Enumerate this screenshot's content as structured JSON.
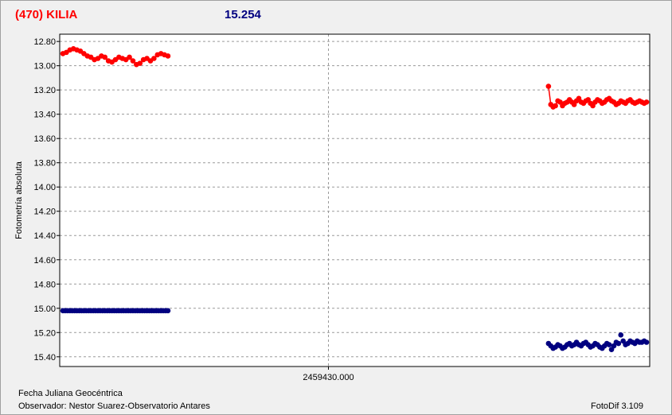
{
  "header": {
    "object": "(470) KILIA",
    "magnitude": "15.254",
    "object_color": "#ff0000",
    "magnitude_color": "#000080"
  },
  "footer": {
    "xlabel": "Fecha Juliana Geocéntrica",
    "observer": "Observador: Nestor Suarez-Observatorio Antares",
    "software": "FotoDif 3.109"
  },
  "chart_data": {
    "type": "scatter",
    "ylabel": "Fotometría absoluta",
    "y_inverted": true,
    "ylim": [
      12.74,
      15.48
    ],
    "yticks": [
      "12.80",
      "13.00",
      "13.20",
      "13.40",
      "13.60",
      "13.80",
      "14.00",
      "14.20",
      "14.40",
      "14.60",
      "14.80",
      "15.00",
      "15.20",
      "15.40"
    ],
    "x_center_tick": "2459430.000",
    "grid": true,
    "series": [
      {
        "color": "#ff0000",
        "connected": true,
        "x": [
          0.0,
          0.006,
          0.012,
          0.018,
          0.024,
          0.03,
          0.036,
          0.042,
          0.048,
          0.054,
          0.06,
          0.066,
          0.072,
          0.078,
          0.084,
          0.09,
          0.096,
          0.102,
          0.108,
          0.114,
          0.12,
          0.126,
          0.132,
          0.138,
          0.144,
          0.15,
          0.156,
          0.162,
          0.168,
          0.174,
          0.18
        ],
        "y": [
          12.9,
          12.89,
          12.87,
          12.86,
          12.87,
          12.88,
          12.9,
          12.92,
          12.93,
          12.95,
          12.94,
          12.92,
          12.93,
          12.96,
          12.97,
          12.95,
          12.93,
          12.94,
          12.95,
          12.93,
          12.96,
          12.99,
          12.98,
          12.95,
          12.94,
          12.96,
          12.94,
          12.91,
          12.9,
          12.91,
          12.92
        ]
      },
      {
        "color": "#ff0000",
        "connected": true,
        "x": [
          0.832,
          0.836,
          0.84,
          0.844,
          0.848,
          0.852,
          0.856,
          0.86,
          0.864,
          0.868,
          0.872,
          0.876,
          0.88,
          0.884,
          0.888,
          0.892,
          0.896,
          0.9,
          0.904,
          0.908,
          0.912,
          0.916,
          0.92,
          0.924,
          0.928,
          0.932,
          0.936,
          0.94,
          0.944,
          0.948,
          0.952,
          0.956,
          0.96,
          0.964,
          0.968,
          0.972,
          0.976,
          0.98,
          0.984,
          0.988,
          0.992,
          0.996,
          1.0
        ],
        "y": [
          13.17,
          13.32,
          13.34,
          13.33,
          13.29,
          13.3,
          13.33,
          13.31,
          13.3,
          13.28,
          13.3,
          13.32,
          13.29,
          13.27,
          13.3,
          13.31,
          13.29,
          13.28,
          13.31,
          13.33,
          13.3,
          13.28,
          13.29,
          13.31,
          13.3,
          13.28,
          13.27,
          13.29,
          13.3,
          13.32,
          13.31,
          13.29,
          13.3,
          13.31,
          13.29,
          13.28,
          13.3,
          13.31,
          13.3,
          13.29,
          13.3,
          13.31,
          13.3
        ]
      },
      {
        "color": "#000080",
        "connected": false,
        "x": [
          0.0,
          0.004,
          0.008,
          0.012,
          0.016,
          0.02,
          0.024,
          0.028,
          0.032,
          0.036,
          0.04,
          0.044,
          0.048,
          0.052,
          0.056,
          0.06,
          0.064,
          0.068,
          0.072,
          0.076,
          0.08,
          0.084,
          0.088,
          0.092,
          0.096,
          0.1,
          0.104,
          0.108,
          0.112,
          0.116,
          0.12,
          0.124,
          0.128,
          0.132,
          0.136,
          0.14,
          0.144,
          0.148,
          0.152,
          0.156,
          0.16,
          0.164,
          0.168,
          0.172,
          0.176,
          0.18
        ],
        "y": [
          15.02,
          15.02,
          15.02,
          15.02,
          15.02,
          15.02,
          15.02,
          15.02,
          15.02,
          15.02,
          15.02,
          15.02,
          15.02,
          15.02,
          15.02,
          15.02,
          15.02,
          15.02,
          15.02,
          15.02,
          15.02,
          15.02,
          15.02,
          15.02,
          15.02,
          15.02,
          15.02,
          15.02,
          15.02,
          15.02,
          15.02,
          15.02,
          15.02,
          15.02,
          15.02,
          15.02,
          15.02,
          15.02,
          15.02,
          15.02,
          15.02,
          15.02,
          15.02,
          15.02,
          15.02,
          15.02
        ]
      },
      {
        "color": "#000080",
        "connected": false,
        "x": [
          0.832,
          0.836,
          0.84,
          0.844,
          0.848,
          0.852,
          0.856,
          0.86,
          0.864,
          0.868,
          0.872,
          0.876,
          0.88,
          0.884,
          0.888,
          0.892,
          0.896,
          0.9,
          0.904,
          0.908,
          0.912,
          0.916,
          0.92,
          0.924,
          0.928,
          0.932,
          0.936,
          0.94,
          0.944,
          0.948,
          0.952,
          0.956,
          0.96,
          0.964,
          0.968,
          0.972,
          0.976,
          0.98,
          0.984,
          0.988,
          0.992,
          0.996,
          1.0
        ],
        "y": [
          15.29,
          15.31,
          15.33,
          15.32,
          15.3,
          15.31,
          15.33,
          15.32,
          15.3,
          15.29,
          15.31,
          15.3,
          15.28,
          15.3,
          15.31,
          15.29,
          15.28,
          15.3,
          15.32,
          15.31,
          15.29,
          15.3,
          15.32,
          15.33,
          15.31,
          15.29,
          15.3,
          15.34,
          15.31,
          15.28,
          15.29,
          15.22,
          15.27,
          15.3,
          15.29,
          15.27,
          15.28,
          15.29,
          15.27,
          15.28,
          15.28,
          15.27,
          15.28
        ]
      }
    ]
  }
}
